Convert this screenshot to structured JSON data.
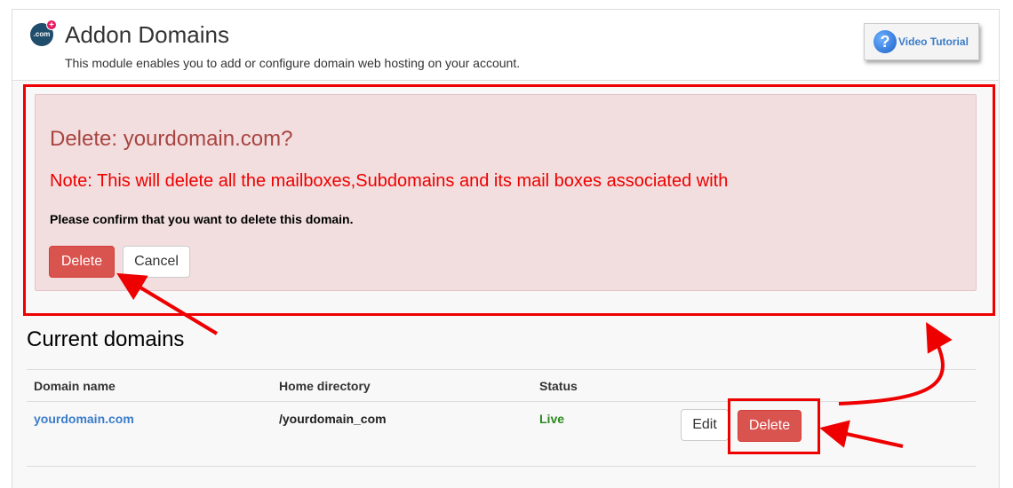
{
  "header": {
    "logo_text": ".com",
    "logo_badge": "+",
    "title": "Addon Domains",
    "description": "This module enables you to add or configure domain web hosting on your account.",
    "video_tutorial_label": "Video Tutorial",
    "video_tutorial_icon": "?"
  },
  "alert": {
    "title": "Delete: yourdomain.com?",
    "note": "Note: This will delete all the mailboxes,Subdomains and its mail boxes associated with",
    "confirm_text": "Please confirm that you want to delete this domain.",
    "delete_label": "Delete",
    "cancel_label": "Cancel"
  },
  "domains": {
    "section_title": "Current domains",
    "columns": [
      "Domain name",
      "Home directory",
      "Status"
    ],
    "rows": [
      {
        "domain": "yourdomain.com",
        "home_directory": "/yourdomain_com",
        "status": "Live",
        "edit_label": "Edit",
        "delete_label": "Delete"
      }
    ]
  },
  "colors": {
    "annotation_red": "#ee0000",
    "danger_button": "#d9534f",
    "alert_background": "#f2dede",
    "link_blue": "#3a7cc9",
    "status_green": "#2c8a1f"
  }
}
